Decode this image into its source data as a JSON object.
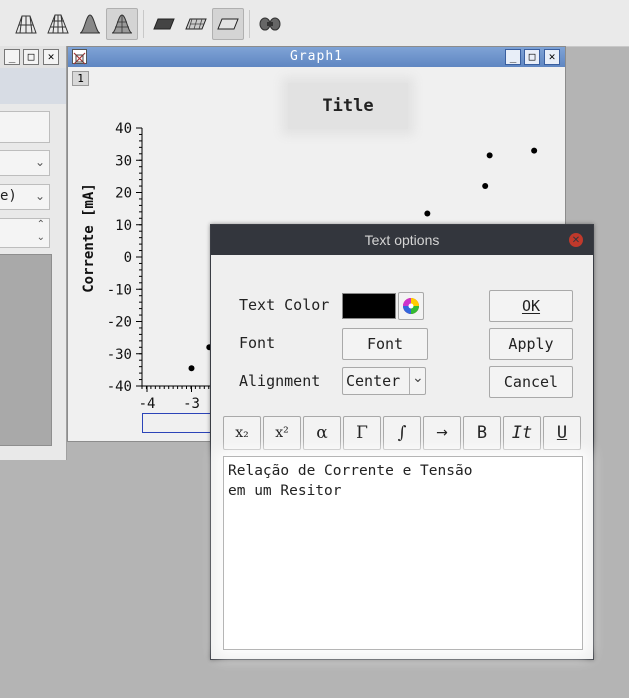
{
  "toolbar": {
    "icons": [
      "surface-wireframe-icon",
      "surface-mesh-icon",
      "surface-gradient-icon",
      "surface-filled-icon",
      "plane-xy-icon",
      "plane-hatched-icon",
      "plane-outline-icon",
      "link-icon"
    ]
  },
  "left_window": {
    "combo_2_text": "e)"
  },
  "graph_window": {
    "title": "Graph1",
    "layer_label": "1",
    "plot_title": "Title",
    "ylabel": "Corrente [mA]"
  },
  "chart_data": {
    "type": "scatter",
    "title": "Title",
    "xlabel": "",
    "ylabel": "Corrente [mA]",
    "ylim": [
      -40,
      40
    ],
    "yticks": [
      "40",
      "30",
      "20",
      "10",
      "0",
      "-10",
      "-20",
      "-30",
      "-40"
    ],
    "xticks_visible": [
      "-4",
      "-3"
    ],
    "x": [
      -3.0,
      -2.6,
      2.3,
      3.6,
      3.7,
      4.7
    ],
    "y": [
      -34.5,
      -28.0,
      13.5,
      22.0,
      31.5,
      33.0
    ],
    "grid": false,
    "marker_color": "#000000"
  },
  "dialog": {
    "title": "Text options",
    "text_color_label": "Text Color",
    "text_color_value": "#000000",
    "font_label": "Font",
    "font_button": "Font",
    "alignment_label": "Alignment",
    "alignment_value": "Center",
    "ok_button": "OK",
    "apply_button": "Apply",
    "cancel_button": "Cancel",
    "format_buttons": {
      "subscript": "x₂",
      "superscript": "x²",
      "alpha": "α",
      "gamma": "Γ",
      "integral": "∫",
      "arrow": "→",
      "bold": "B",
      "italic": "It",
      "underline": "U"
    },
    "text_content": "Relação de Corrente e Tensão\nem um Resitor"
  },
  "colors": {
    "dialog_titlebar": "#33363d",
    "graph_titlebar": "#6f94cc",
    "close_button": "#c0392b"
  }
}
